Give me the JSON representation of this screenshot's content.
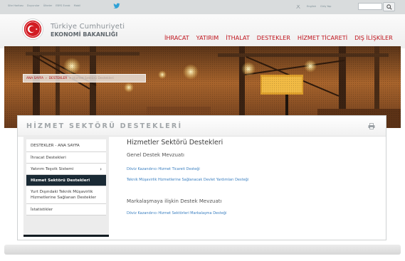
{
  "topbar": {
    "links": [
      "Site Haritası",
      "Duyurular",
      "Ülkeler",
      "EBYS Evrak",
      "Mobil"
    ],
    "right_links": [
      "English",
      "Giriş Yap"
    ],
    "search_placeholder": ""
  },
  "header": {
    "brand_line1": "Türkiye Cumhuriyeti",
    "brand_line2": "EKONOMİ BAKANLIĞI",
    "nav": [
      "İHRACAT",
      "YATIRIM",
      "İTHALAT",
      "DESTEKLER",
      "HİZMET TİCARETİ",
      "DIŞ İLİŞKİLER"
    ]
  },
  "breadcrumb": {
    "items": [
      "ANA SAYFA",
      "DESTEKLER",
      "Hizmet Sektörü Destekleri"
    ]
  },
  "panel": {
    "title": "HİZMET SEKTÖRÜ DESTEKLERİ"
  },
  "sidebar": {
    "items": [
      {
        "label": "DESTEKLER - ANA SAYFA"
      },
      {
        "label": "İhracat Destekleri"
      },
      {
        "label": "Yatırım Teşvik Sistemi"
      },
      {
        "label": "Hizmet Sektörü Destekleri"
      },
      {
        "label_line1": "Yurt Dışındaki Teknik Müşavirlik",
        "label_line2": "Hizmetlerine Sağlanan Destekler"
      },
      {
        "label": "İstatistikler"
      }
    ]
  },
  "content": {
    "title": "Hizmetler Sektörü Destekleri",
    "section1": "Genel Destek Mevzuatı",
    "link1": "Döviz Kazandırıcı Hizmet Ticareti Desteği",
    "link2": "Teknik Müşavirlik Hizmetlerine Sağlanacak Devlet Yardımları Desteği",
    "section2": "Markalaşmaya ilişkin Destek Mevzuatı",
    "link3": "Döviz Kazandırıcı Hizmet Sektörleri Markalaşma Desteği"
  },
  "colors": {
    "brand_red": "#c0141d",
    "active_nav_bg": "#1a2a35",
    "link_blue": "#3a7fc0"
  }
}
